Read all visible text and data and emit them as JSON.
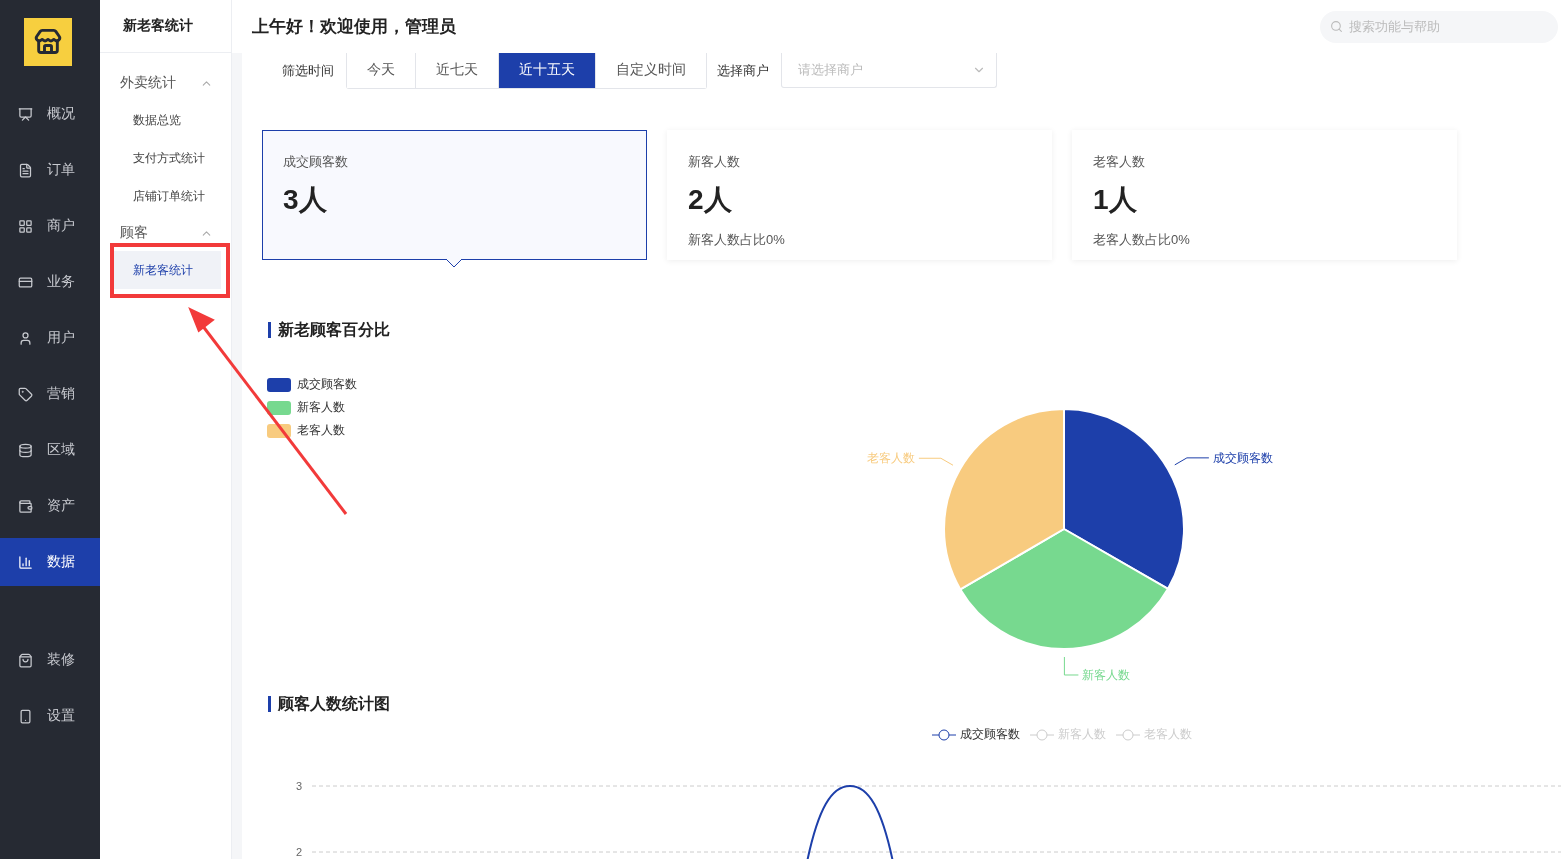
{
  "sidebar": {
    "items": [
      {
        "label": "概况",
        "selected": false
      },
      {
        "label": "订单",
        "selected": false
      },
      {
        "label": "商户",
        "selected": false
      },
      {
        "label": "业务",
        "selected": false
      },
      {
        "label": "用户",
        "selected": false
      },
      {
        "label": "营销",
        "selected": false
      },
      {
        "label": "区域",
        "selected": false
      },
      {
        "label": "资产",
        "selected": false
      },
      {
        "label": "数据",
        "selected": true
      },
      {
        "label": "装修",
        "selected": false
      },
      {
        "label": "设置",
        "selected": false
      }
    ]
  },
  "submenu": {
    "title": "新老客统计",
    "groups": [
      {
        "label": "外卖统计",
        "expanded": true,
        "children": [
          {
            "label": "数据总览",
            "selected": false
          },
          {
            "label": "支付方式统计",
            "selected": false
          },
          {
            "label": "店铺订单统计",
            "selected": false
          }
        ]
      },
      {
        "label": "顾客",
        "expanded": true,
        "children": [
          {
            "label": "新老客统计",
            "selected": true
          }
        ]
      }
    ]
  },
  "header": {
    "greeting": "上午好！欢迎使用，管理员",
    "search": {
      "placeholder": "搜索功能与帮助"
    }
  },
  "filters": {
    "time_label": "筛选时间",
    "ranges": [
      {
        "label": "今天",
        "selected": false
      },
      {
        "label": "近七天",
        "selected": false
      },
      {
        "label": "近十五天",
        "selected": true
      },
      {
        "label": "自定义时间",
        "selected": false
      }
    ],
    "merchant_label": "选择商户",
    "merchant_select": {
      "placeholder": "请选择商户"
    }
  },
  "cards": [
    {
      "title": "成交顾客数",
      "value": "3人",
      "selected": true
    },
    {
      "title": "新客人数",
      "value": "2人",
      "note": "新客人数占比0%",
      "selected": false
    },
    {
      "title": "老客人数",
      "value": "1人",
      "note": "老客人数占比0%",
      "selected": false
    }
  ],
  "pie_section": {
    "title": "新老顾客百分比",
    "chart_data": {
      "type": "pie",
      "categories": [
        "成交顾客数",
        "新客人数",
        "老客人数"
      ],
      "values": [
        33.3,
        33.3,
        33.4
      ],
      "colors": [
        "#1d3faa",
        "#77d98f",
        "#f8cb7f"
      ]
    }
  },
  "line_section": {
    "title": "顾客人数统计图",
    "legend": [
      {
        "name": "成交顾客数",
        "selected": true
      },
      {
        "name": "新客人数",
        "selected": false
      },
      {
        "name": "老客人数",
        "selected": false
      }
    ],
    "y_axis_labels": [
      "3",
      "2"
    ]
  },
  "annotations": {
    "highlight_box": true,
    "arrow": true
  }
}
